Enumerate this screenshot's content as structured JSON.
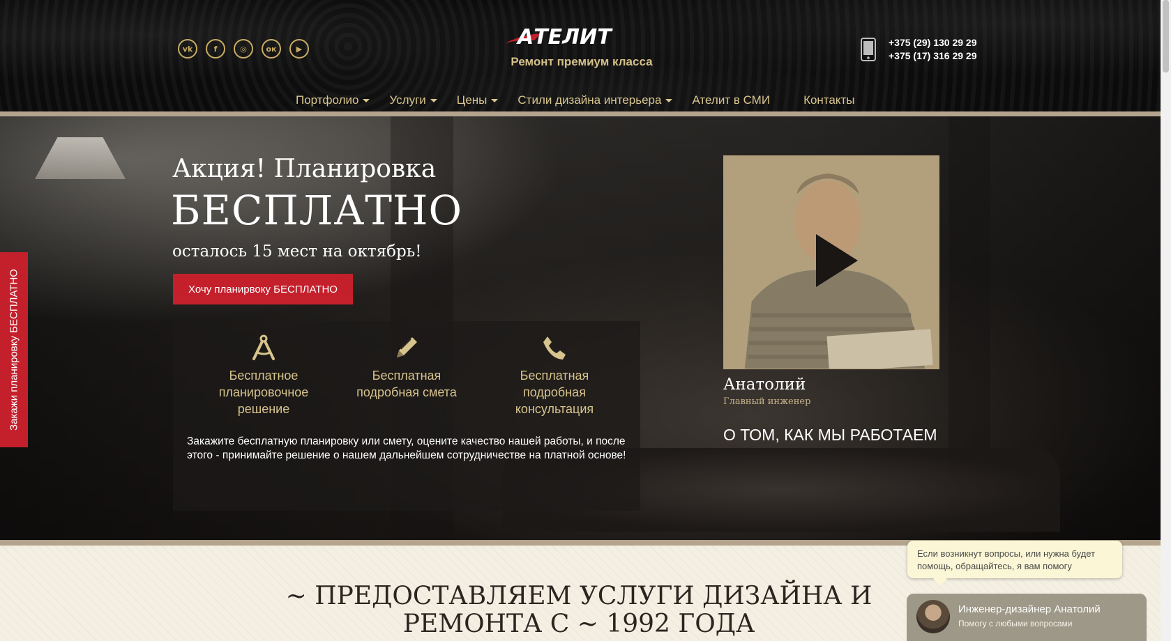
{
  "header": {
    "socials": [
      {
        "icon": "vk-icon",
        "glyph": "vk"
      },
      {
        "icon": "facebook-icon",
        "glyph": "f"
      },
      {
        "icon": "instagram-icon",
        "glyph": "◎"
      },
      {
        "icon": "odnoklassniki-icon",
        "glyph": "ок"
      },
      {
        "icon": "youtube-icon",
        "glyph": "▶"
      }
    ],
    "logo_text": "АТЕЛИТ",
    "tagline": "Ремонт премиум класса",
    "phones": [
      "+375 (29) 130 29 29",
      "+375 (17) 316 29 29"
    ],
    "nav": [
      {
        "label": "Портфолио",
        "dropdown": true
      },
      {
        "label": "Услуги",
        "dropdown": true
      },
      {
        "label": "Цены",
        "dropdown": true
      },
      {
        "label": "Стили дизайна интерьера",
        "dropdown": true
      },
      {
        "label": "Ателит в СМИ",
        "dropdown": false
      },
      {
        "label": "Контакты",
        "dropdown": false
      }
    ]
  },
  "hero": {
    "title_line1": "Акция! Планировка",
    "title_line2": "БЕСПЛАТНО",
    "subtitle": "осталось 15 мест на октябрь!",
    "cta_label": "Хочу планирвоку БЕСПЛАТНО",
    "benefits": [
      {
        "icon": "compass-icon",
        "label": "Бесплатное планировочное решение"
      },
      {
        "icon": "pencil-icon",
        "label": "Бесплатная подробная смета"
      },
      {
        "icon": "phone-icon",
        "label": "Бесплатная подробная консультация"
      }
    ],
    "benefits_text": "Закажите бесплатную планировку или смету, оцените качество нашей работы, и после этого - принимайте решение о нашем дальнейшем сотрудничестве на платной основе!",
    "video": {
      "person_name": "Анатолий",
      "person_role": "Главный инженер",
      "link_label": "О ТОМ, КАК МЫ РАБОТАЕМ"
    }
  },
  "side_tab": {
    "label": "Закажи планировку БЕСПЛАТНО"
  },
  "services": {
    "title": "~  ПРЕДОСТАВЛЯЕМ УСЛУГИ ДИЗАЙНА И РЕМОНТА С  ~ 1992 ГОДА"
  },
  "chat": {
    "bubble_text": "Если возникнут вопросы, или нужна будет помощь, обращайтесь, я вам помогу",
    "agent_name": "Инженер-дизайнер Анатолий",
    "agent_sub": "Помогу с любыми вопросами"
  },
  "colors": {
    "accent_gold": "#c9ad63",
    "cta_red": "#c4202c",
    "band": "#b4a48d"
  }
}
